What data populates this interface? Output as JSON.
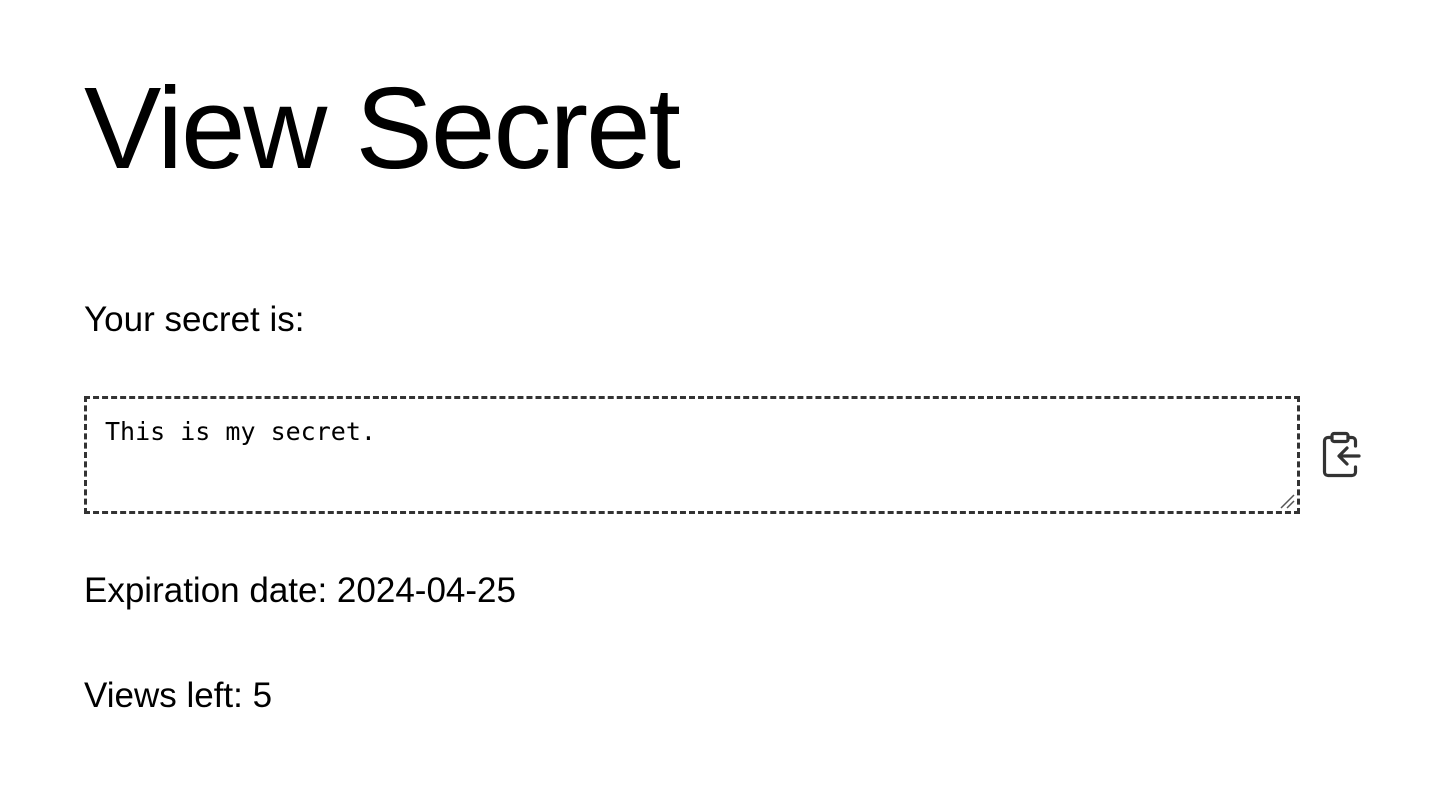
{
  "page": {
    "title": "View Secret"
  },
  "secret": {
    "label": "Your secret is:",
    "value": "This is my secret.",
    "copy_icon": "clipboard-copy-icon"
  },
  "meta": {
    "expiration": "Expiration date: 2024-04-25",
    "views": "Views left: 5"
  },
  "colors": {
    "text": "#000000",
    "border": "#333333",
    "icon": "#333333",
    "background": "#ffffff"
  }
}
